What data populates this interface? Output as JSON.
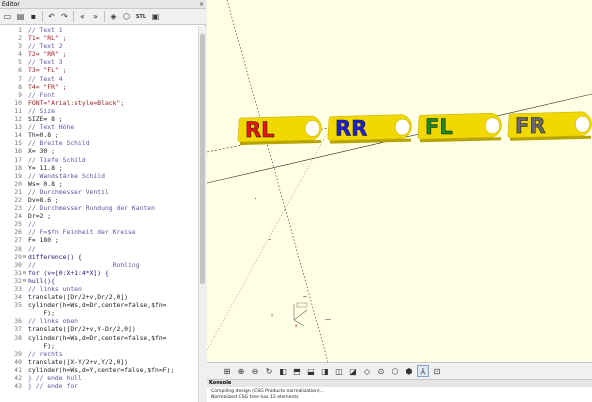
{
  "editor": {
    "title": "Editor",
    "close": "×",
    "toolbar": [
      {
        "name": "new-file-icon",
        "glyph": "▭"
      },
      {
        "name": "open-file-icon",
        "glyph": "▤"
      },
      {
        "name": "save-icon",
        "glyph": "▪"
      },
      {
        "name": "undo-icon",
        "glyph": "↶"
      },
      {
        "name": "redo-icon",
        "glyph": "↷"
      },
      {
        "name": "unindent-icon",
        "glyph": "«"
      },
      {
        "name": "indent-icon",
        "glyph": "»"
      },
      {
        "name": "preview-icon",
        "glyph": "◈"
      },
      {
        "name": "render-icon",
        "glyph": "⬡"
      },
      {
        "name": "export-stl-button",
        "glyph": "STL"
      },
      {
        "name": "send-to-print-icon",
        "glyph": "▣"
      }
    ],
    "lines": [
      {
        "n": "1",
        "t": "// Text 1",
        "c": "cmt"
      },
      {
        "n": "2",
        "t": "T1= \"RL\" ;",
        "c": "str"
      },
      {
        "n": "3",
        "t": "// Text 2",
        "c": "cmt"
      },
      {
        "n": "4",
        "t": "T2= \"RR\" ;",
        "c": "str"
      },
      {
        "n": "5",
        "t": "// Text 3",
        "c": "cmt"
      },
      {
        "n": "6",
        "t": "T3= \"FL\" ;",
        "c": "str"
      },
      {
        "n": "7",
        "t": "// Text 4",
        "c": "cmt"
      },
      {
        "n": "8",
        "t": "T4= \"FR\" ;",
        "c": "str"
      },
      {
        "n": "9",
        "t": "// Font",
        "c": "cmt"
      },
      {
        "n": "10",
        "t": "FONT=\"Arial:style=Black\";",
        "c": "str"
      },
      {
        "n": "11",
        "t": "// Size",
        "c": "cmt"
      },
      {
        "n": "12",
        "t": "SIZE= 8 ;",
        "c": ""
      },
      {
        "n": "13",
        "t": "// Text Höhe",
        "c": "cmt"
      },
      {
        "n": "14",
        "t": "Th=0.8 ;",
        "c": ""
      },
      {
        "n": "15",
        "t": "// Breite Schild",
        "c": "cmt"
      },
      {
        "n": "16",
        "t": "X= 30 ;",
        "c": ""
      },
      {
        "n": "17",
        "t": "// Tiefe Schild",
        "c": "cmt"
      },
      {
        "n": "18",
        "t": "Y= 11.8 ;",
        "c": ""
      },
      {
        "n": "19",
        "t": "// Wandstärke Schild",
        "c": "cmt"
      },
      {
        "n": "20",
        "t": "Ws= 0.8 ;",
        "c": ""
      },
      {
        "n": "21",
        "t": "// Durchmesser Ventil",
        "c": "cmt"
      },
      {
        "n": "22",
        "t": "Dv=8.6 ;",
        "c": ""
      },
      {
        "n": "23",
        "t": "// Durchmesser Rundung der Kanten",
        "c": "cmt"
      },
      {
        "n": "24",
        "t": "Dr=2 ;",
        "c": ""
      },
      {
        "n": "25",
        "t": "//",
        "c": "cmt"
      },
      {
        "n": "26",
        "t": "// F=$fn Feinheit der Kreise",
        "c": "cmt"
      },
      {
        "n": "27",
        "t": "F= 180 ;",
        "c": ""
      },
      {
        "n": "28",
        "t": "//",
        "c": "cmt"
      },
      {
        "n": "29",
        "t": "difference() {",
        "c": "kw",
        "f": "⊟"
      },
      {
        "n": "30",
        "t": "//                    Rohling",
        "c": "cmt"
      },
      {
        "n": "31",
        "t": "for (v=[0:X+1:4*X]) {",
        "c": "kw",
        "f": "⊟"
      },
      {
        "n": "32",
        "t": "hull(){",
        "c": "kw",
        "f": "⊟"
      },
      {
        "n": "33",
        "t": "// links unten",
        "c": "cmt"
      },
      {
        "n": "34",
        "t": "translate([Dr/2+v,Dr/2,0])",
        "c": ""
      },
      {
        "n": "35",
        "t": "cylinder(h=Ws,d=Dr,center=false,$fn=",
        "c": ""
      },
      {
        "n": "",
        "t": "    F);",
        "c": ""
      },
      {
        "n": "36",
        "t": "// links oben",
        "c": "cmt"
      },
      {
        "n": "37",
        "t": "translate([Dr/2+v,Y-Dr/2,0])",
        "c": ""
      },
      {
        "n": "38",
        "t": "cylinder(h=Ws,d=Dr,center=false,$fn=",
        "c": ""
      },
      {
        "n": "",
        "t": "    F);",
        "c": ""
      },
      {
        "n": "39",
        "t": "// rechts",
        "c": "cmt"
      },
      {
        "n": "40",
        "t": "translate([X-Y/2+v,Y/2,0])",
        "c": ""
      },
      {
        "n": "41",
        "t": "cylinder(h=Ws,d=Y,center=false,$fn=F);",
        "c": ""
      },
      {
        "n": "42",
        "t": "} // ende hull",
        "c": "cmt"
      },
      {
        "n": "43",
        "t": "} // ende for",
        "c": "cmt"
      }
    ]
  },
  "viewport": {
    "tags": [
      {
        "label": "RL",
        "color": "#e8141c"
      },
      {
        "label": "RR",
        "color": "#2020d8"
      },
      {
        "label": "FL",
        "color": "#1e8a1e"
      },
      {
        "label": "FR",
        "color": "#6a6a6a"
      }
    ],
    "plate_color": "#f0d800",
    "toolbar": [
      {
        "name": "view-all-icon",
        "glyph": "⊞"
      },
      {
        "name": "zoom-in-icon",
        "glyph": "⊕"
      },
      {
        "name": "zoom-out-icon",
        "glyph": "⊖"
      },
      {
        "name": "reset-view-icon",
        "glyph": "↻"
      },
      {
        "name": "view-right-icon",
        "glyph": "◧"
      },
      {
        "name": "view-top-icon",
        "glyph": "⬒"
      },
      {
        "name": "view-bottom-icon",
        "glyph": "⬓"
      },
      {
        "name": "view-left-icon",
        "glyph": "◨"
      },
      {
        "name": "view-front-icon",
        "glyph": "◫"
      },
      {
        "name": "view-back-icon",
        "glyph": "◪"
      },
      {
        "name": "view-diagonal-icon",
        "glyph": "◇"
      },
      {
        "name": "view-center-icon",
        "glyph": "⊙"
      },
      {
        "name": "perspective-icon",
        "glyph": "⬡"
      },
      {
        "name": "orthogonal-icon",
        "glyph": "⬢"
      },
      {
        "name": "show-axes-icon",
        "glyph": "⅄"
      },
      {
        "name": "show-edges-icon",
        "glyph": "⊡"
      }
    ]
  },
  "console": {
    "title": "Konsole",
    "lines": [
      "Compiling design (CSG Products normalization)...",
      "Normalized CSG tree has 12 elements"
    ]
  }
}
